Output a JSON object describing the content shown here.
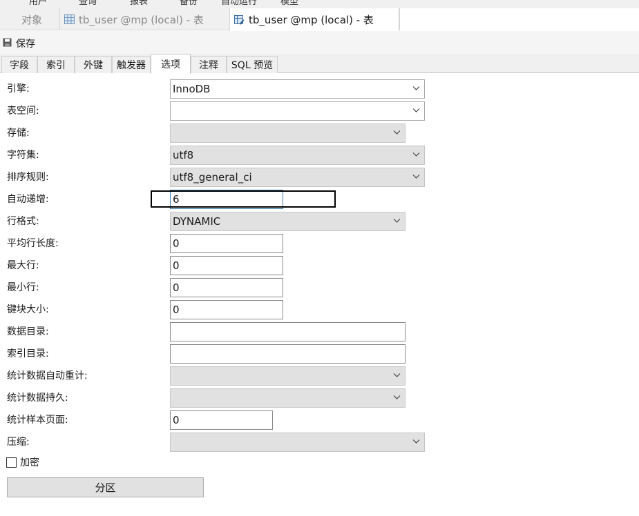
{
  "menu": {
    "items": [
      "用户",
      "查询",
      "报表",
      "备份",
      "自动运行",
      "模型"
    ]
  },
  "tabs": {
    "objects_label": "对象",
    "doc_tab_1": "tb_user @mp (local) - 表",
    "doc_tab_2": "tb_user @mp (local) - 表"
  },
  "toolbar": {
    "save_label": "保存"
  },
  "subtabs": [
    "字段",
    "索引",
    "外键",
    "触发器",
    "选项",
    "注释",
    "SQL 预览"
  ],
  "options": {
    "engine": {
      "label": "引擎:",
      "value": "InnoDB"
    },
    "tablespace": {
      "label": "表空间:",
      "value": ""
    },
    "storage": {
      "label": "存储:",
      "value": ""
    },
    "charset": {
      "label": "字符集:",
      "value": "utf8"
    },
    "collation": {
      "label": "排序规则:",
      "value": "utf8_general_ci"
    },
    "auto_increment": {
      "label": "自动递增:",
      "value": "6"
    },
    "row_format": {
      "label": "行格式:",
      "value": "DYNAMIC"
    },
    "avg_row_length": {
      "label": "平均行长度:",
      "value": "0"
    },
    "max_rows": {
      "label": "最大行:",
      "value": "0"
    },
    "min_rows": {
      "label": "最小行:",
      "value": "0"
    },
    "key_block_size": {
      "label": "键块大小:",
      "value": "0"
    },
    "data_directory": {
      "label": "数据目录:",
      "value": ""
    },
    "index_directory": {
      "label": "索引目录:",
      "value": ""
    },
    "stats_auto_recalc": {
      "label": "统计数据自动重计:",
      "value": ""
    },
    "stats_persistent": {
      "label": "统计数据持久:",
      "value": ""
    },
    "stats_sample_pages": {
      "label": "统计样本页面:",
      "value": "0"
    },
    "compression": {
      "label": "压缩:",
      "value": ""
    },
    "encryption": {
      "label": "加密",
      "checked": false
    },
    "partition_button": "分区"
  }
}
